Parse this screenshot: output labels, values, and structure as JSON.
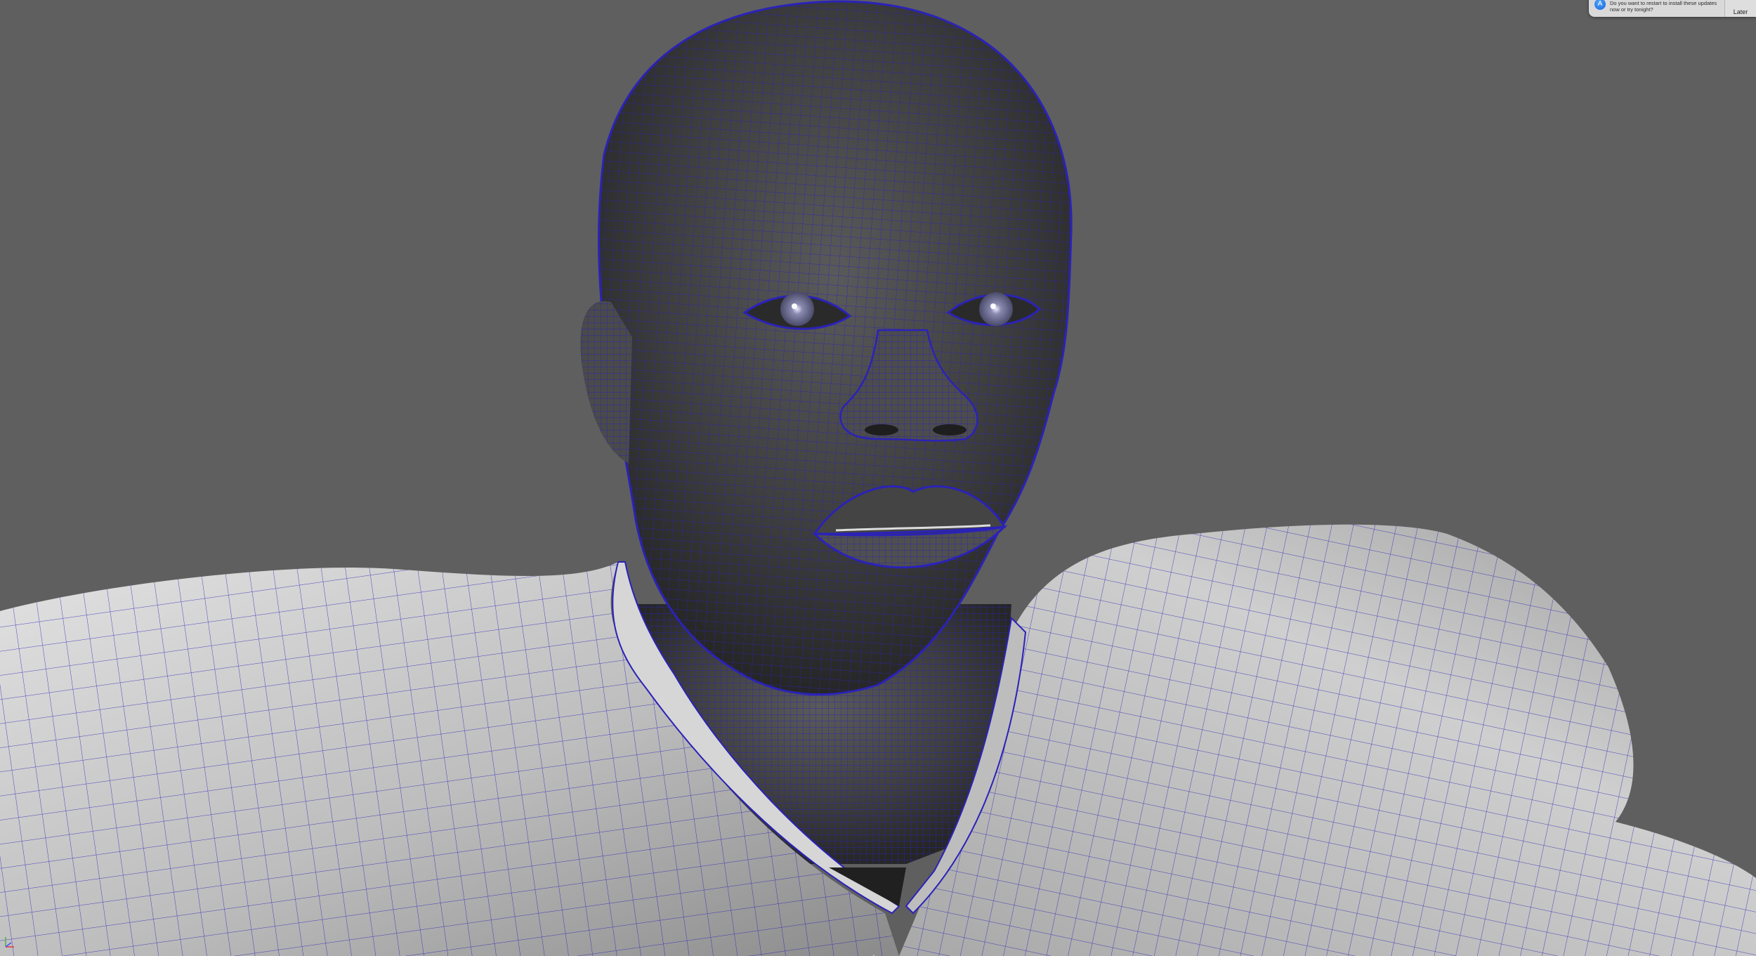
{
  "viewport": {
    "background_color": "#5f5f5f",
    "wireframe_color": "#2b22b8",
    "skin_color": "#3d3d3d",
    "shirt_color": "#c9c9c9"
  },
  "notification": {
    "icon": "app-store-icon",
    "message": "Do you want to restart to install these updates now or try tonight?",
    "later_label": "Later"
  },
  "axis_gizmo": {
    "icon": "axis-gizmo-icon"
  }
}
